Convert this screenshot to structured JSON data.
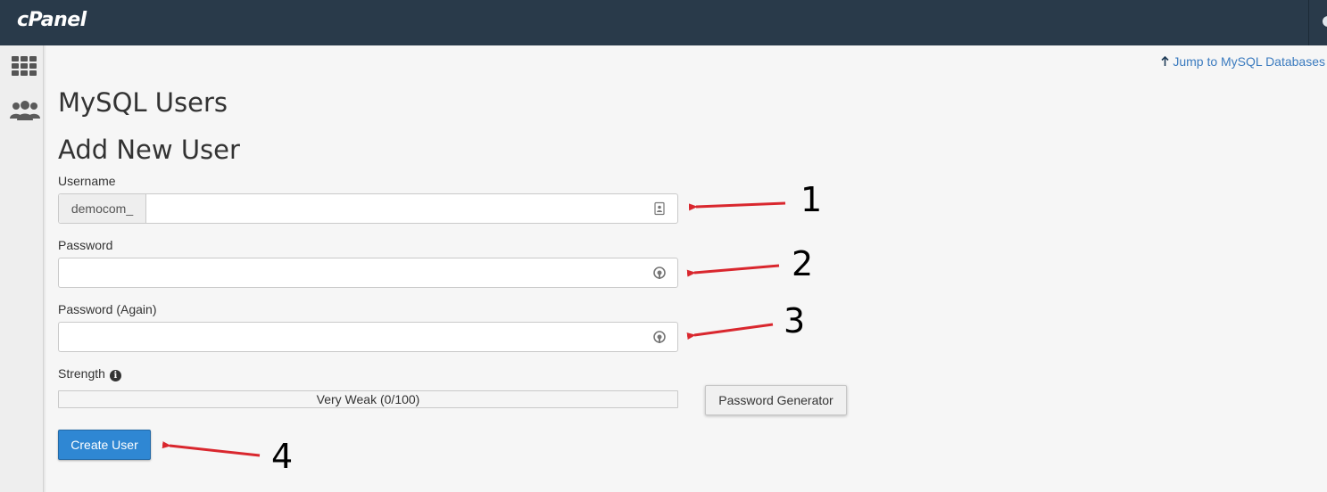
{
  "header": {
    "logo": "cPanel"
  },
  "sidebar": {
    "icons": [
      "grid-icon",
      "users-icon"
    ]
  },
  "top_link": {
    "label": "Jump to MySQL Databases",
    "icon": "arrow-up-icon"
  },
  "page_title": "MySQL Users",
  "section_title": "Add New User",
  "form": {
    "username": {
      "label": "Username",
      "prefix": "democom_",
      "value": "",
      "icon": "contact-card-icon"
    },
    "password": {
      "label": "Password",
      "value": "",
      "icon": "password-reveal-icon"
    },
    "password_again": {
      "label": "Password (Again)",
      "value": "",
      "icon": "password-reveal-icon"
    },
    "strength": {
      "label": "Strength",
      "info_icon": "info-icon",
      "text": "Very Weak (0/100)",
      "score": 0,
      "max": 100
    },
    "generator_button": "Password Generator",
    "submit_button": "Create User"
  },
  "annotations": {
    "arrow_color": "#d9272e",
    "steps": [
      "1",
      "2",
      "3",
      "4"
    ]
  },
  "colors": {
    "topbar": "#293a4a",
    "link": "#3b7bbf",
    "primary_button": "#2f87d3"
  }
}
